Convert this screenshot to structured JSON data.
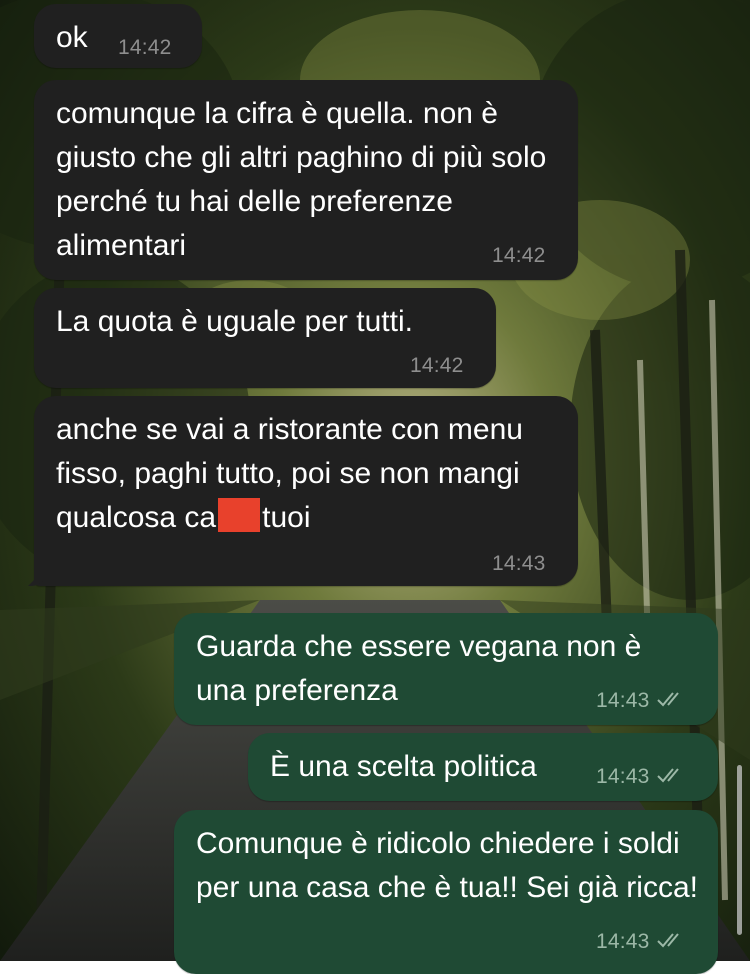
{
  "chat": {
    "messages": [
      {
        "direction": "incoming",
        "text": "ok",
        "time": "14:42"
      },
      {
        "direction": "incoming",
        "text": "comunque la cifra è quella. non è giusto che gli altri paghino di più solo perché tu hai delle preferenze alimentari",
        "time": "14:42"
      },
      {
        "direction": "incoming",
        "text": "La quota è uguale per tutti.",
        "time": "14:42"
      },
      {
        "direction": "incoming",
        "text_before": "anche se vai a ristorante con menu fisso, paghi tutto, poi se non mangi qualcosa ca",
        "text_after": "tuoi",
        "redacted": true,
        "time": "14:43"
      },
      {
        "direction": "outgoing",
        "text": "Guarda che essere vegana non è una preferenza",
        "time": "14:43",
        "status": "read"
      },
      {
        "direction": "outgoing",
        "text": "È una scelta politica",
        "time": "14:43",
        "status": "read"
      },
      {
        "direction": "outgoing",
        "text": "Comunque è ridicolo chiedere i soldi per una casa che è tua!! Sei già ricca!",
        "time": "14:43",
        "status": "read"
      }
    ]
  },
  "colors": {
    "incoming_bubble": "#202020",
    "outgoing_bubble": "#1f4a34",
    "redaction": "#e8412c",
    "timestamp": "#8e8e8e"
  },
  "icons": {
    "read_receipt": "double-check-icon"
  }
}
